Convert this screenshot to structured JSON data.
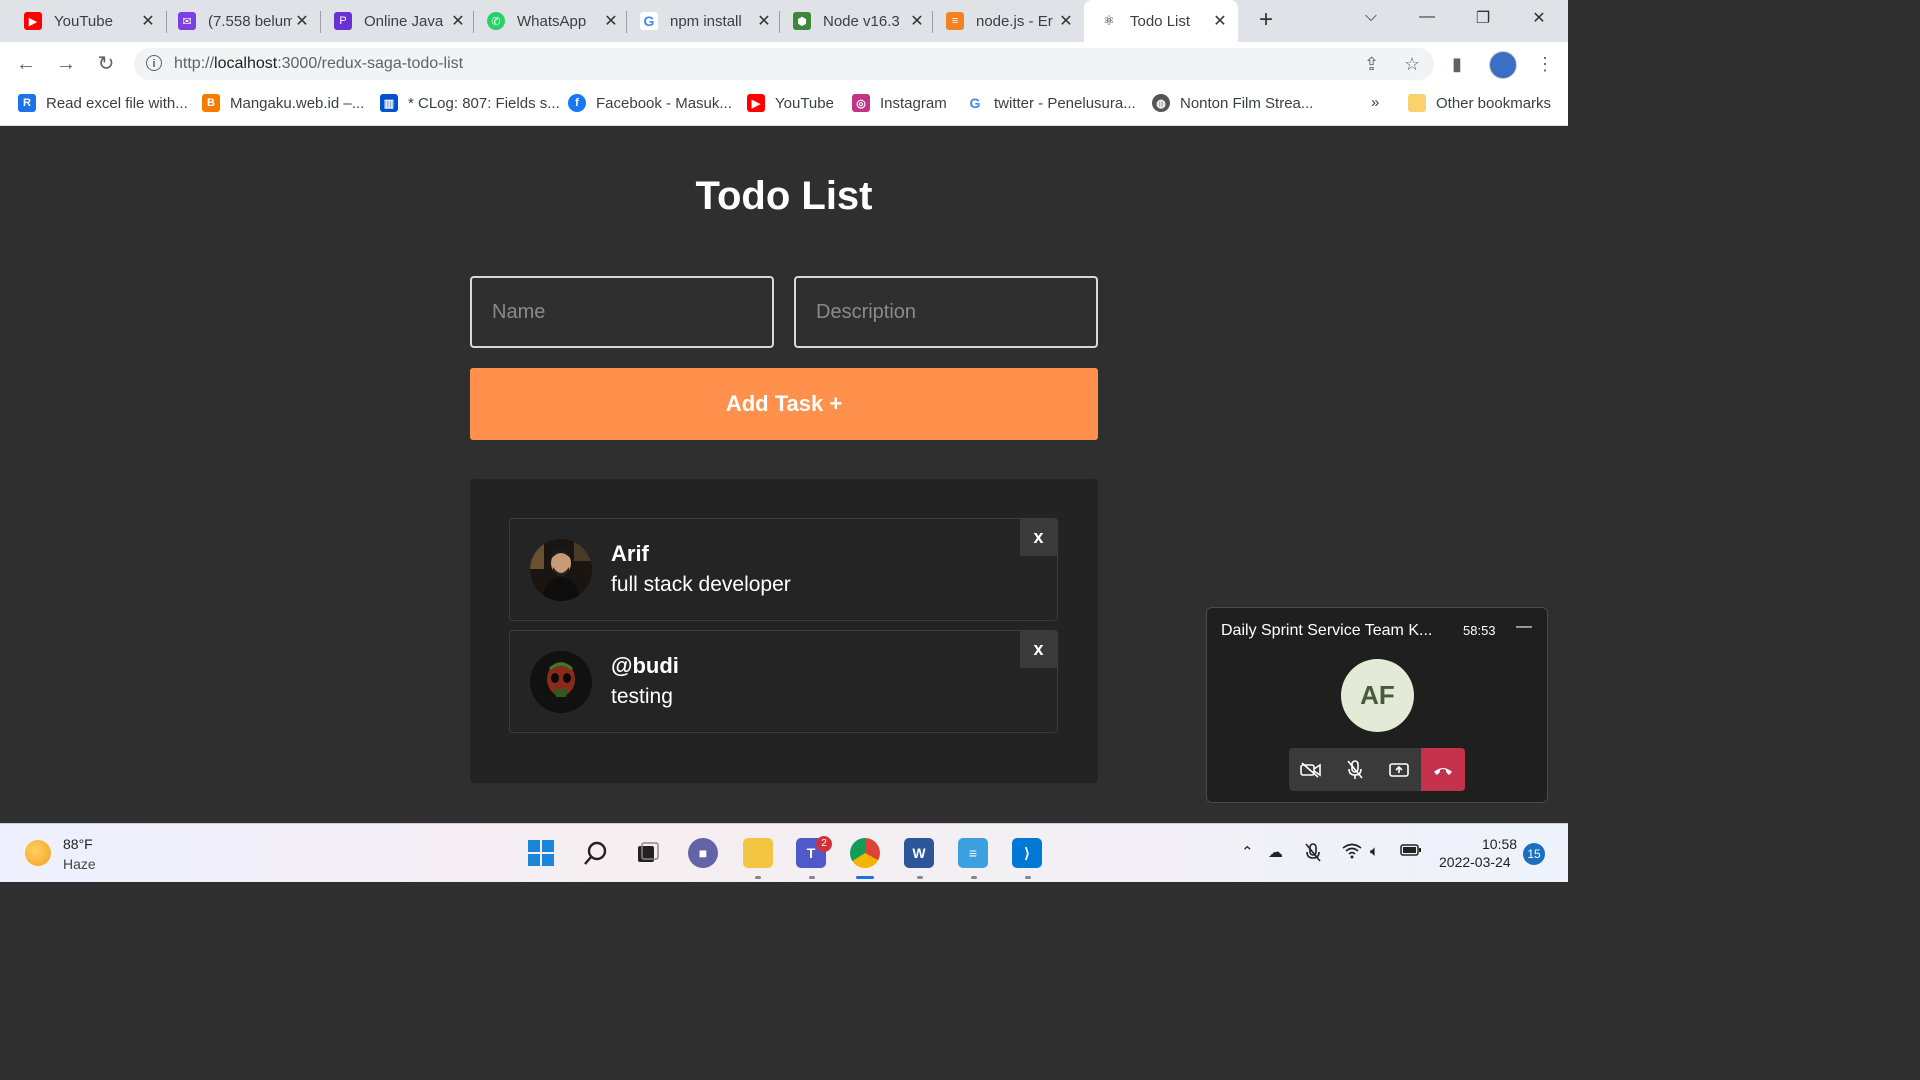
{
  "browser": {
    "tabs": [
      {
        "title": "YouTube",
        "icon": "youtube-icon",
        "color": "#ff0000"
      },
      {
        "title": "(7.558 belum",
        "icon": "mail-icon",
        "color": "#7b3fe4"
      },
      {
        "title": "Online Java",
        "icon": "code-icon",
        "color": "#6b2fd6"
      },
      {
        "title": "WhatsApp",
        "icon": "whatsapp-icon",
        "color": "#25d366"
      },
      {
        "title": "npm install",
        "icon": "google-icon",
        "color": "#4285f4"
      },
      {
        "title": "Node v16.3",
        "icon": "nodejs-icon",
        "color": "#3c873a"
      },
      {
        "title": "node.js - Er",
        "icon": "stackoverflow-icon",
        "color": "#f48024"
      },
      {
        "title": "Todo List",
        "icon": "react-icon",
        "color": "#222222"
      }
    ],
    "address": {
      "scheme": "http://",
      "host": "localhost",
      "path": ":3000/redux-saga-todo-list"
    },
    "bookmarks": [
      {
        "label": "Read excel file with...",
        "color": "#1a73e8"
      },
      {
        "label": "Mangaku.web.id –...",
        "color": "#f57c00"
      },
      {
        "label": "* CLog: 807: Fields s...",
        "color": "#0052cc"
      },
      {
        "label": "Facebook - Masuk...",
        "color": "#1877f2"
      },
      {
        "label": "YouTube",
        "color": "#ff0000"
      },
      {
        "label": "Instagram",
        "color": "#c13584"
      },
      {
        "label": "twitter - Penelusura...",
        "color": "#4285f4"
      },
      {
        "label": "Nonton Film Strea...",
        "color": "#555555"
      }
    ],
    "overflow": "»",
    "other_bookmarks": "Other bookmarks"
  },
  "app": {
    "title": "Todo List",
    "name_placeholder": "Name",
    "description_placeholder": "Description",
    "add_button": "Add Task +",
    "accent_color": "#ff914d",
    "tasks": [
      {
        "name": "Arif",
        "description": "full stack developer",
        "delete": "x"
      },
      {
        "name": "@budi",
        "description": "testing",
        "delete": "x"
      }
    ]
  },
  "call": {
    "title": "Daily Sprint Service Team K...",
    "duration": "58:53",
    "initials": "AF",
    "end_color": "#c4314b"
  },
  "taskbar": {
    "temperature": "88°F",
    "condition": "Haze",
    "teams_badge": "2",
    "time": "10:58",
    "date": "2022-03-24",
    "notifications": "15"
  }
}
